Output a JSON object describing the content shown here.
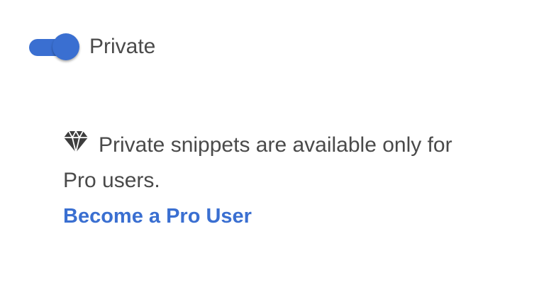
{
  "visibility": {
    "toggle_on": true,
    "label": "Private"
  },
  "notice": {
    "icon": "diamond-icon",
    "line1": "Private snippets are available only for",
    "line2": "Pro users.",
    "link_label": "Become a Pro User"
  },
  "colors": {
    "accent": "#3a6fd1",
    "text": "#4a4a4a",
    "background": "#ffffff"
  }
}
